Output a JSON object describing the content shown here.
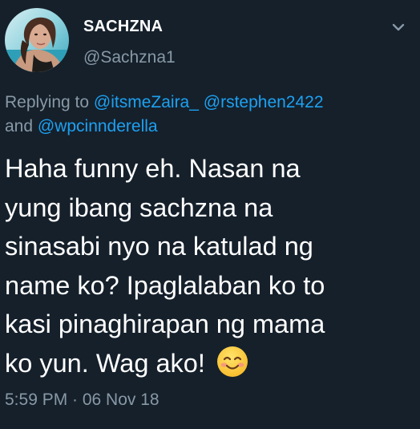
{
  "author": {
    "display_name": "SACHZNA",
    "handle": "@Sachzna1"
  },
  "reply": {
    "prefix": "Replying to ",
    "mention_1": "@itsmeZaira_",
    "mention_2": "@rstephen2422",
    "conjunction": "and ",
    "mention_3": "@wpcinnderella"
  },
  "tweet": {
    "lines": [
      "Haha funny eh. Nasan na",
      "yung ibang sachzna na",
      "sinasabi nyo na katulad ng",
      "name ko? Ipaglalaban ko to",
      "kasi pinaghirapan ng mama",
      "ko yun. Wag ako! "
    ],
    "emoji": "smiling-face-with-smiling-eyes-icon"
  },
  "meta": {
    "timestamp": "5:59 PM · 06 Nov 18"
  },
  "colors": {
    "background": "#15202b",
    "secondary_text": "#8899a6",
    "link": "#1da1f2",
    "primary_text": "#ffffff"
  }
}
